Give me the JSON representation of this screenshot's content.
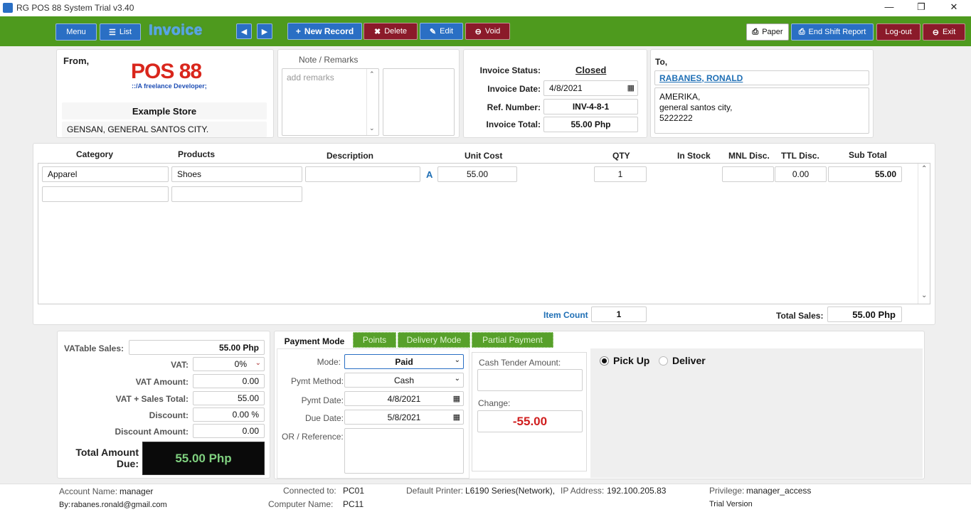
{
  "window": {
    "title": "RG POS 88 System Trial v3.40"
  },
  "toolbar": {
    "menu": "Menu",
    "list": "List",
    "invoice_title": "Invoice",
    "new_record": "New Record",
    "delete": "Delete",
    "edit": "Edit",
    "void": "Void",
    "paper": "Paper",
    "end_shift": "End Shift Report",
    "logout": "Log-out",
    "exit": "Exit"
  },
  "from": {
    "label": "From,",
    "logo_text": "POS 88",
    "logo_tagline": "::/A freelance Developer;",
    "store_name": "Example Store",
    "store_address": "GENSAN, GENERAL SANTOS CITY."
  },
  "notes": {
    "label": "Note / Remarks",
    "placeholder": "add remarks"
  },
  "invoice_info": {
    "status_label": "Invoice Status:",
    "status": "Closed",
    "date_label": "Invoice Date:",
    "date": "4/8/2021",
    "ref_label": "Ref.  Number:",
    "ref": "INV-4-8-1",
    "total_label": "Invoice Total:",
    "total": "55.00 Php"
  },
  "to": {
    "label": "To,",
    "customer": "RABANES, RONALD",
    "address_lines": [
      "AMERIKA,",
      "general santos city,",
      "5222222"
    ]
  },
  "items": {
    "headers": {
      "category": "Category",
      "products": "Products",
      "description": "Description",
      "unit_cost": "Unit Cost",
      "qty": "QTY",
      "in_stock": "In Stock",
      "mnl_disc": "MNL Disc.",
      "ttl_disc": "TTL Disc.",
      "sub_total": "Sub Total"
    },
    "rows": [
      {
        "category": "Apparel",
        "product": "Shoes",
        "description": "",
        "flag": "A",
        "unit_cost": "55.00",
        "qty": "1",
        "in_stock": "",
        "mnl_disc": "",
        "ttl_disc": "0.00",
        "sub_total": "55.00"
      }
    ],
    "item_count_label": "Item Count",
    "item_count": "1",
    "total_sales_label": "Total Sales:",
    "total_sales": "55.00 Php"
  },
  "totals": {
    "vatable_label": "VATable Sales:",
    "vatable": "55.00 Php",
    "vat_label": "VAT:",
    "vat": "0%",
    "vat_amount_label": "VAT Amount:",
    "vat_amount": "0.00",
    "vat_sales_label": "VAT + Sales Total:",
    "vat_sales": "55.00",
    "discount_label": "Discount:",
    "discount": "0.00 %",
    "discount_amount_label": "Discount Amount:",
    "discount_amount": "0.00",
    "due_label_1": "Total Amount",
    "due_label_2": "Due:",
    "due": "55.00 Php"
  },
  "payment": {
    "tabs": [
      "Payment Mode",
      "Points",
      "Delivery Mode",
      "Partial Payment"
    ],
    "mode_label": "Mode:",
    "mode": "Paid",
    "method_label": "Pymt Method:",
    "method": "Cash",
    "pymt_date_label": "Pymt Date:",
    "pymt_date": "4/8/2021",
    "due_date_label": "Due Date:",
    "due_date": "5/8/2021",
    "or_label": "OR / Reference:",
    "cash_tender_label": "Cash Tender Amount:",
    "cash_tender": "",
    "change_label": "Change:",
    "change": "-55.00",
    "pickup": "Pick Up",
    "deliver": "Deliver"
  },
  "status_bar": {
    "account_label": "Account Name:",
    "account": "manager",
    "by_label": "By:",
    "by": "rabanes.ronald@gmail.com",
    "connected_label": "Connected to:",
    "connected": "PC01",
    "computer_label": "Computer Name:",
    "computer": "PC11",
    "printer_label": "Default Printer:",
    "printer": "L6190 Series(Network),",
    "ip_label": "IP Address:",
    "ip": "192.100.205.83",
    "privilege_label": "Privilege:",
    "privilege": "manager_access",
    "trial": "Trial Version"
  },
  "colors": {
    "toolbar_green": "#4e9a1e",
    "button_blue": "#2a6fc4",
    "button_red": "#8b1a2a",
    "link_blue": "#1f6fb5",
    "change_red": "#d01f1f",
    "due_green": "#7fd07f"
  }
}
